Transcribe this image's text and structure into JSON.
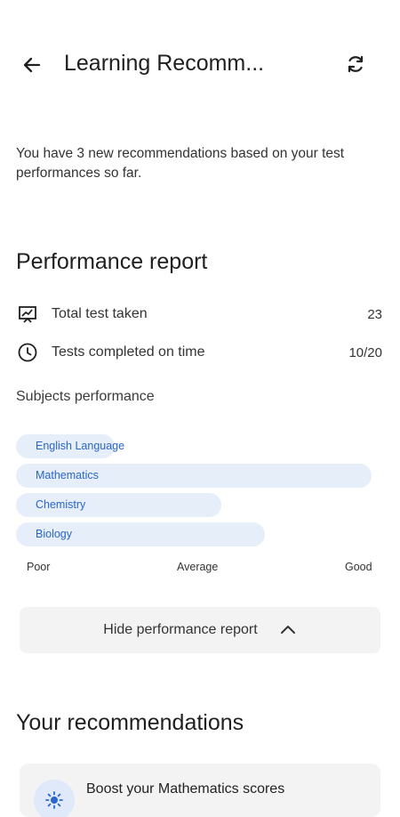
{
  "header": {
    "title": "Learning Recomm...",
    "back_icon": "arrow-left-icon",
    "refresh_icon": "refresh-icon"
  },
  "intro_text": "You have 3 new recommendations based on your test performances so far.",
  "performance": {
    "title": "Performance report",
    "stats": [
      {
        "label": "Total test taken",
        "value": "23",
        "icon": "presentation-chart-icon"
      },
      {
        "label": "Tests completed on time",
        "value": "10/20",
        "icon": "clock-icon"
      }
    ],
    "subjects_label": "Subjects performance",
    "subjects": [
      {
        "name": "English Language",
        "level": 0.27
      },
      {
        "name": "Mathematics",
        "level": 0.97
      },
      {
        "name": "Chemistry",
        "level": 0.56
      },
      {
        "name": "Biology",
        "level": 0.68
      }
    ],
    "scale": [
      "Poor",
      "Average",
      "Good"
    ],
    "bar_color": "#e6eefa",
    "bar_text_color": "#2a66cc",
    "toggle_label": "Hide performance report",
    "toggle_icon": "chevron-up-icon"
  },
  "recommendations": {
    "title": "Your recommendations",
    "items": [
      {
        "title": "Boost your Mathematics scores",
        "icon": "sun-icon"
      }
    ]
  }
}
